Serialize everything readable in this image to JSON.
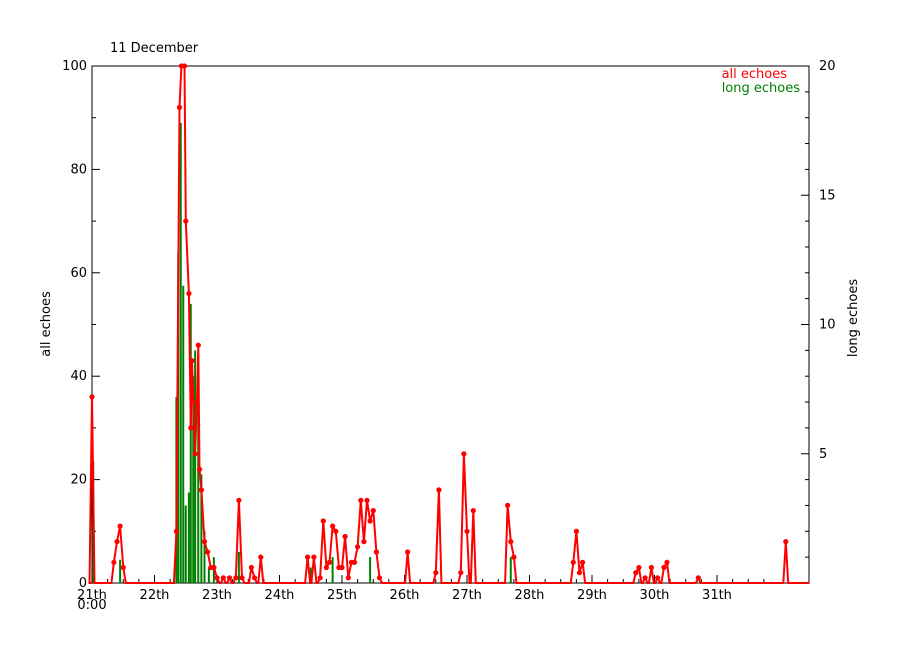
{
  "chart_data": {
    "type": "line",
    "title": "11 December",
    "xlabel": "",
    "x_tick_labels": [
      "21th",
      "22th",
      "23th",
      "24th",
      "25th",
      "26th",
      "27th",
      "28th",
      "29th",
      "30th",
      "31th"
    ],
    "x_origin_label": "0:00",
    "xlim_days": [
      0,
      11.5
    ],
    "left_axis": {
      "label": "all echoes",
      "ylim": [
        0,
        100
      ],
      "ticks": [
        "0",
        "20",
        "40",
        "60",
        "80",
        "100"
      ]
    },
    "right_axis": {
      "label": "long echoes",
      "ylim": [
        0,
        20
      ],
      "ticks": [
        "5",
        "10",
        "15",
        "20"
      ]
    },
    "legend": {
      "position": "top-right"
    },
    "series": [
      {
        "name": "all echoes",
        "axis": "left",
        "color": "#ff0000",
        "style": "line-with-dots",
        "points": [
          [
            0.0,
            36
          ],
          [
            0.35,
            4
          ],
          [
            0.4,
            8
          ],
          [
            0.45,
            11
          ],
          [
            0.5,
            3
          ],
          [
            1.35,
            10
          ],
          [
            1.4,
            92
          ],
          [
            1.43,
            100
          ],
          [
            1.48,
            100
          ],
          [
            1.5,
            70
          ],
          [
            1.55,
            56
          ],
          [
            1.58,
            30
          ],
          [
            1.6,
            43
          ],
          [
            1.65,
            25
          ],
          [
            1.68,
            35
          ],
          [
            1.7,
            46
          ],
          [
            1.72,
            22
          ],
          [
            1.75,
            18
          ],
          [
            1.8,
            8
          ],
          [
            1.85,
            6
          ],
          [
            1.9,
            3
          ],
          [
            1.95,
            3
          ],
          [
            2.0,
            1
          ],
          [
            2.1,
            1
          ],
          [
            2.2,
            1
          ],
          [
            2.3,
            1
          ],
          [
            2.35,
            16
          ],
          [
            2.4,
            1
          ],
          [
            2.55,
            3
          ],
          [
            2.6,
            1
          ],
          [
            2.7,
            5
          ],
          [
            3.45,
            5
          ],
          [
            3.55,
            5
          ],
          [
            3.65,
            1
          ],
          [
            3.7,
            12
          ],
          [
            3.75,
            3
          ],
          [
            3.8,
            4
          ],
          [
            3.85,
            11
          ],
          [
            3.9,
            10
          ],
          [
            3.95,
            3
          ],
          [
            4.0,
            3
          ],
          [
            4.05,
            9
          ],
          [
            4.1,
            1
          ],
          [
            4.15,
            4
          ],
          [
            4.2,
            4
          ],
          [
            4.25,
            7
          ],
          [
            4.3,
            16
          ],
          [
            4.35,
            8
          ],
          [
            4.4,
            16
          ],
          [
            4.45,
            12
          ],
          [
            4.5,
            14
          ],
          [
            4.55,
            6
          ],
          [
            4.6,
            1
          ],
          [
            5.05,
            6
          ],
          [
            5.5,
            2
          ],
          [
            5.55,
            18
          ],
          [
            5.9,
            2
          ],
          [
            5.95,
            25
          ],
          [
            6.0,
            10
          ],
          [
            6.1,
            14
          ],
          [
            6.65,
            15
          ],
          [
            6.7,
            8
          ],
          [
            6.75,
            5
          ],
          [
            7.7,
            4
          ],
          [
            7.75,
            10
          ],
          [
            7.8,
            2
          ],
          [
            7.85,
            4
          ],
          [
            8.7,
            2
          ],
          [
            8.75,
            3
          ],
          [
            8.85,
            1
          ],
          [
            8.95,
            3
          ],
          [
            9.05,
            1
          ],
          [
            9.15,
            3
          ],
          [
            9.2,
            4
          ],
          [
            9.7,
            1
          ],
          [
            11.1,
            8
          ]
        ]
      },
      {
        "name": "long echoes",
        "axis": "right",
        "color": "#008000",
        "style": "bars",
        "points": [
          [
            0.02,
            4.7
          ],
          [
            0.45,
            0.9
          ],
          [
            1.35,
            7.2
          ],
          [
            1.38,
            12.8
          ],
          [
            1.42,
            17.8
          ],
          [
            1.46,
            11.5
          ],
          [
            1.5,
            3.0
          ],
          [
            1.55,
            3.5
          ],
          [
            1.58,
            10.8
          ],
          [
            1.62,
            8.0
          ],
          [
            1.65,
            9.0
          ],
          [
            1.7,
            8.5
          ],
          [
            1.75,
            4.2
          ],
          [
            1.8,
            2.0
          ],
          [
            1.87,
            0.6
          ],
          [
            1.95,
            1.0
          ],
          [
            2.35,
            1.2
          ],
          [
            3.5,
            0.6
          ],
          [
            3.85,
            1.0
          ],
          [
            4.45,
            1.0
          ],
          [
            6.7,
            1.0
          ]
        ]
      }
    ]
  }
}
